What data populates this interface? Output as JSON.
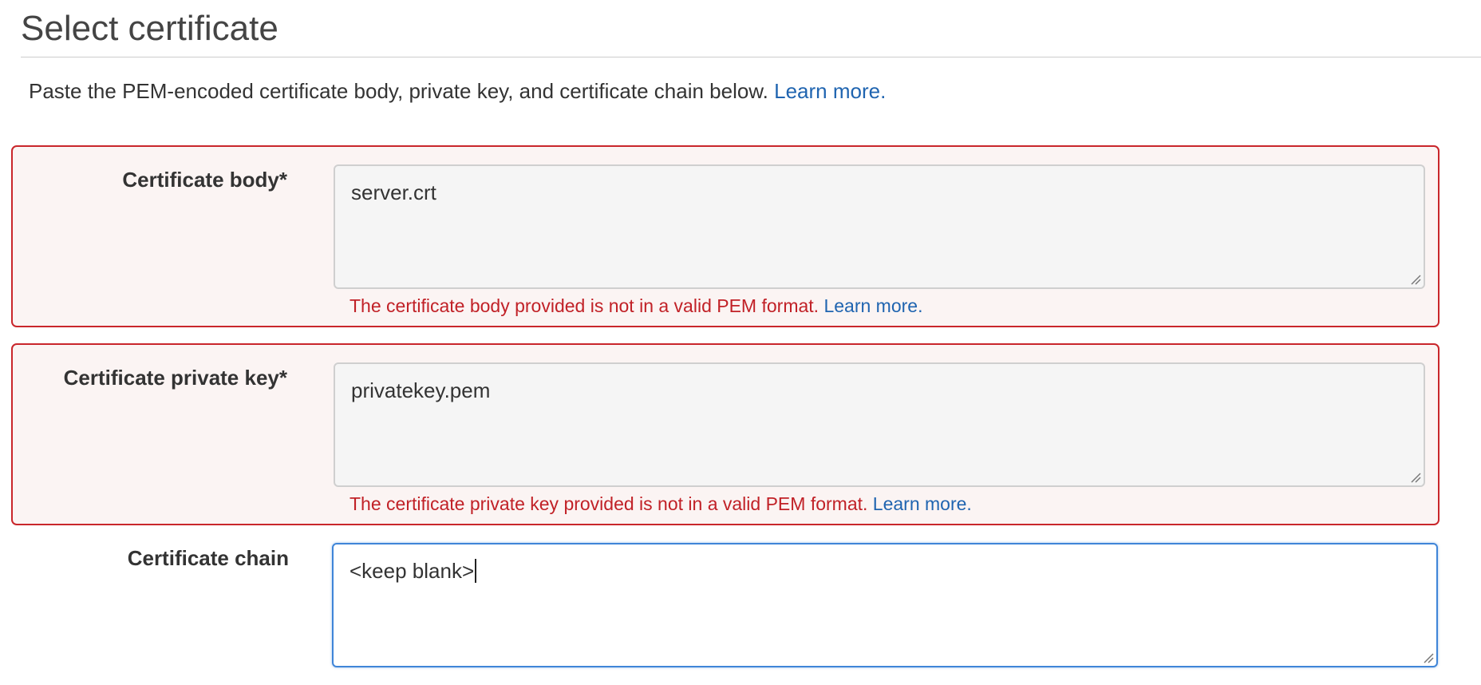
{
  "header": {
    "title": "Select certificate"
  },
  "intro": {
    "text": "Paste the PEM-encoded certificate body, private key, and certificate chain below.",
    "link": "Learn more."
  },
  "fields": {
    "body": {
      "label": "Certificate body*",
      "value": "server.crt",
      "error": "The certificate body provided is not in a valid PEM format.",
      "error_link": "Learn more."
    },
    "private_key": {
      "label": "Certificate private key*",
      "value": "privatekey.pem",
      "error": "The certificate private key provided is not in a valid PEM format.",
      "error_link": "Learn more."
    },
    "chain": {
      "label": "Certificate chain",
      "value": "<keep blank>"
    }
  },
  "colors": {
    "link": "#1f64b0",
    "error_text": "#c12127",
    "error_border": "#c9262b",
    "error_background": "#fbf4f3",
    "focus_border": "#3f85d8"
  },
  "icons": {
    "resize_handle": "resize-handle-icon"
  }
}
